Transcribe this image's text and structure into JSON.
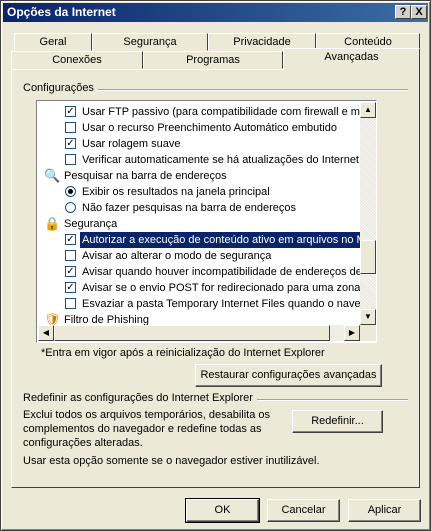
{
  "window": {
    "title": "Opções da Internet",
    "help_button": "?",
    "close_button": "X"
  },
  "tabs_back": [
    "Geral",
    "Segurança",
    "Privacidade",
    "Conteúdo"
  ],
  "tabs_front": [
    "Conexões",
    "Programas",
    "Avançadas"
  ],
  "active_tab": "Avançadas",
  "settings_group": {
    "label": "Configurações",
    "rows": [
      {
        "kind": "checkbox",
        "checked": true,
        "label": "Usar FTP passivo (para compatibilidade com firewall e mod"
      },
      {
        "kind": "checkbox",
        "checked": false,
        "label": "Usar o recurso Preenchimento Automático embutido"
      },
      {
        "kind": "checkbox",
        "checked": true,
        "label": "Usar rolagem suave"
      },
      {
        "kind": "checkbox",
        "checked": false,
        "label": "Verificar automaticamente se há atualizações do Internet I"
      },
      {
        "kind": "group",
        "icon": "search-icon",
        "label": "Pesquisar na barra de endereços"
      },
      {
        "kind": "radio",
        "checked": true,
        "label": "Exibir os resultados na janela principal"
      },
      {
        "kind": "radio",
        "checked": false,
        "label": "Não fazer pesquisas na barra de endereços"
      },
      {
        "kind": "group",
        "icon": "lock-icon",
        "label": "Segurança"
      },
      {
        "kind": "checkbox",
        "checked": true,
        "selected": true,
        "label": "Autorizar a execução de conteúdo ativo em arquivos no M"
      },
      {
        "kind": "checkbox",
        "checked": false,
        "label": "Avisar ao alterar o modo de segurança"
      },
      {
        "kind": "checkbox",
        "checked": true,
        "label": "Avisar quando houver incompatibilidade de endereços de c"
      },
      {
        "kind": "checkbox",
        "checked": true,
        "label": "Avisar se o envio POST for redirecionado para uma zona q"
      },
      {
        "kind": "checkbox",
        "checked": false,
        "label": "Esvaziar a pasta Temporary Internet Files quando o naveg"
      },
      {
        "kind": "group",
        "icon": "phishing-filter-icon",
        "label": "Filtro de Phishing"
      }
    ]
  },
  "restart_note": "*Entra em vigor após a reinicialização do Internet Explorer",
  "restore_button": "Restaurar configurações avançadas",
  "reset_group": {
    "label": "Redefinir as configurações do Internet Explorer",
    "description_lines": [
      "Exclui todos os arquivos temporários, desabilita os",
      "complementos do navegador e redefine todas as",
      "configurações alteradas."
    ],
    "reset_button": "Redefinir...",
    "note": "Usar esta opção somente se o navegador estiver inutilizável."
  },
  "footer": {
    "ok": "OK",
    "cancel": "Cancelar",
    "apply": "Aplicar"
  }
}
